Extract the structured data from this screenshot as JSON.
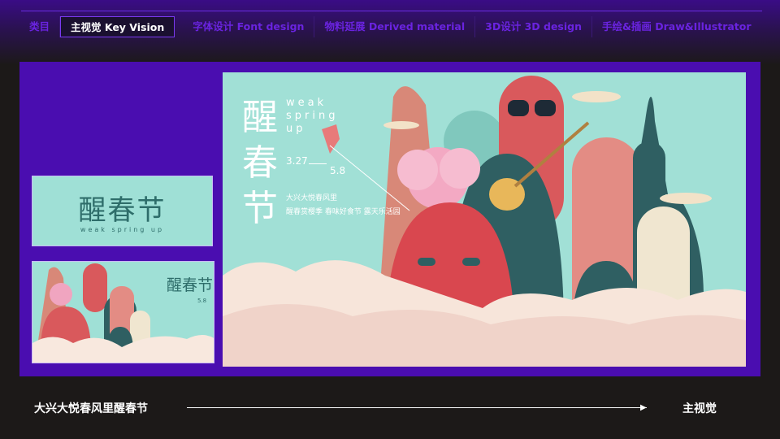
{
  "nav": {
    "items": [
      {
        "label": "类目"
      },
      {
        "label": "主视觉 Key Vision",
        "active": true
      },
      {
        "label": "字体设计 Font design"
      },
      {
        "label": "物料延展  Derived material"
      },
      {
        "label": "3D设计 3D design"
      },
      {
        "label": "手绘&插画 Draw&Illustrator"
      }
    ]
  },
  "logo_card": {
    "title": "醒春节",
    "subtitle": "weak spring up"
  },
  "poster": {
    "title": "醒春节",
    "en": "weak spring up",
    "date_start": "3.27",
    "date_end": "5.8",
    "line1": "大兴大悦春风里",
    "line2": "醒春赏樱季 春味好食节 露天乐活园"
  },
  "mini_poster": {
    "title": "醒春节",
    "date_end": "5.8"
  },
  "footer": {
    "left": "大兴大悦春风里醒春节",
    "right": "主视觉"
  },
  "colors": {
    "accent": "#4a0db0",
    "mint": "#a1e0d6",
    "coral": "#d9595c",
    "teal": "#2f5f62"
  }
}
